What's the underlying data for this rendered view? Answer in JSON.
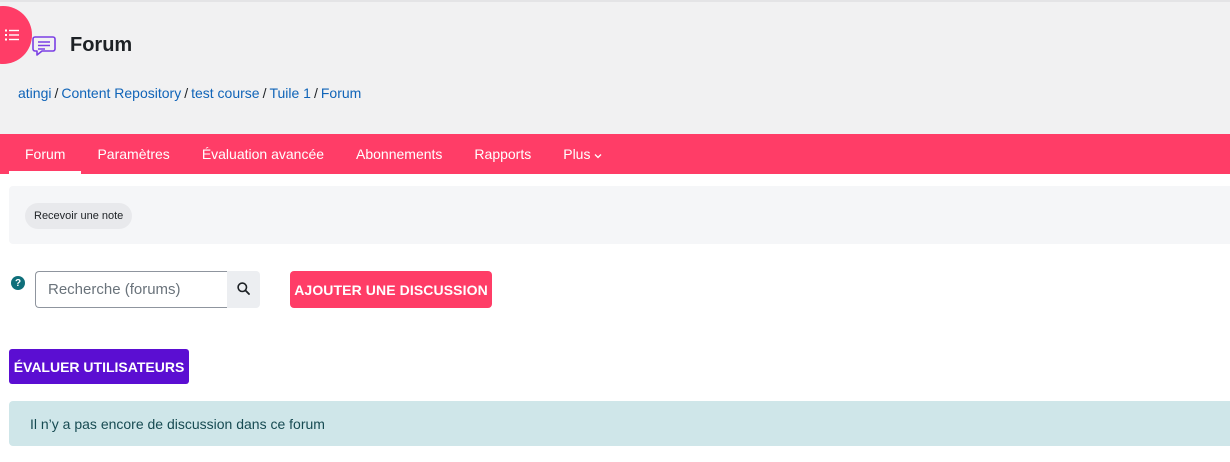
{
  "header": {
    "title": "Forum",
    "breadcrumb": [
      "atingi",
      "Content Repository",
      "test course",
      "Tuile 1",
      "Forum"
    ],
    "separator": "/"
  },
  "nav": {
    "items": [
      {
        "label": "Forum",
        "active": true
      },
      {
        "label": "Paramètres",
        "active": false
      },
      {
        "label": "Évaluation avancée",
        "active": false
      },
      {
        "label": "Abonnements",
        "active": false
      },
      {
        "label": "Rapports",
        "active": false
      },
      {
        "label": "Plus",
        "active": false,
        "has_dropdown": true
      }
    ]
  },
  "activity": {
    "completion_condition": "Recevoir une note"
  },
  "search": {
    "placeholder": "Recherche (forums)",
    "value": "",
    "help_icon": "?"
  },
  "buttons": {
    "add_discussion": "AJOUTER UNE DISCUSSION",
    "grade_users": "ÉVALUER UTILISATEURS"
  },
  "alert": {
    "message": "Il n’y a pas encore de discussion dans ce forum"
  },
  "colors": {
    "brand": "#ff3d67",
    "grade_button": "#5b0ed2",
    "link": "#1064b8",
    "alert_bg": "#cfe6e9",
    "help_icon": "#0f6f7a"
  }
}
